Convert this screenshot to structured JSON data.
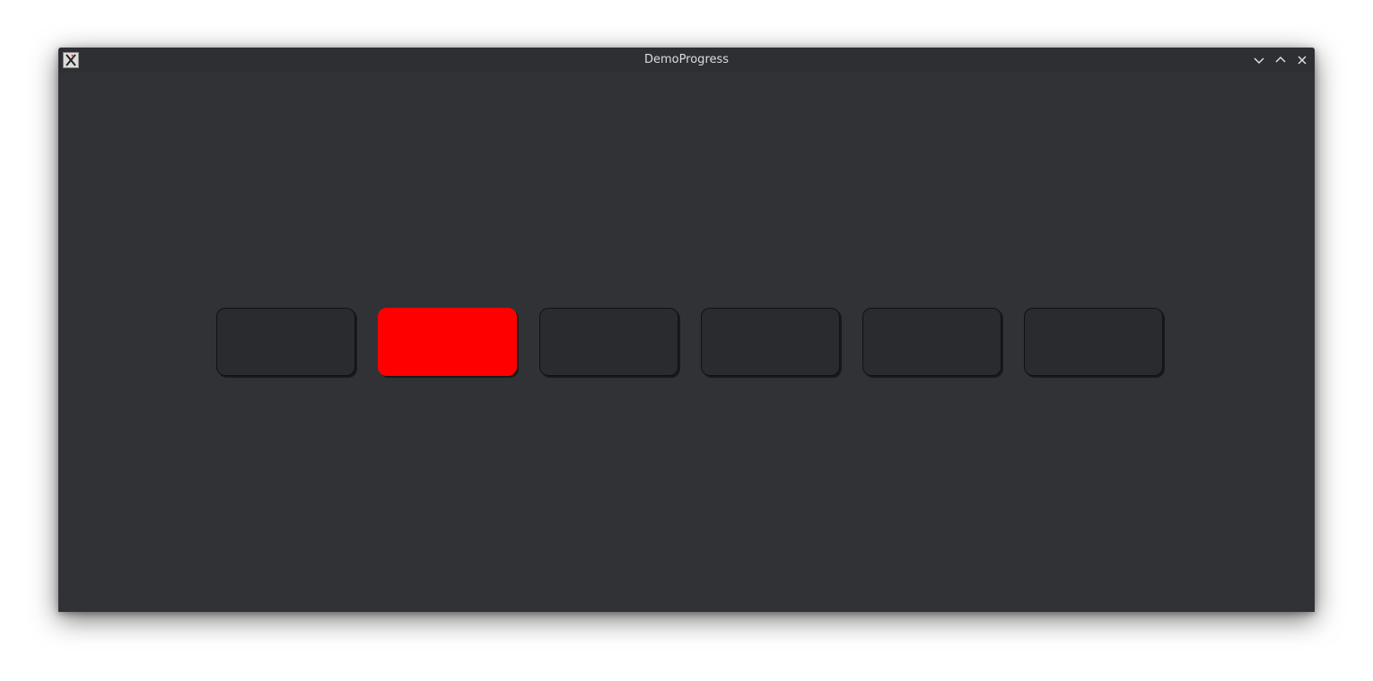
{
  "window": {
    "title": "DemoProgress"
  },
  "icons": {
    "app": "x11-app-icon",
    "minimize": "chevron-down-icon",
    "maximize": "chevron-up-icon",
    "close": "close-icon"
  },
  "progress": {
    "segment_count": 6,
    "active_index": 1,
    "active_color": "#ff0000",
    "inactive_color": "#2a2b2f"
  },
  "colors": {
    "window_background": "#313236",
    "titlebar_background": "#2d2f33",
    "title_text": "#dcdde0"
  }
}
